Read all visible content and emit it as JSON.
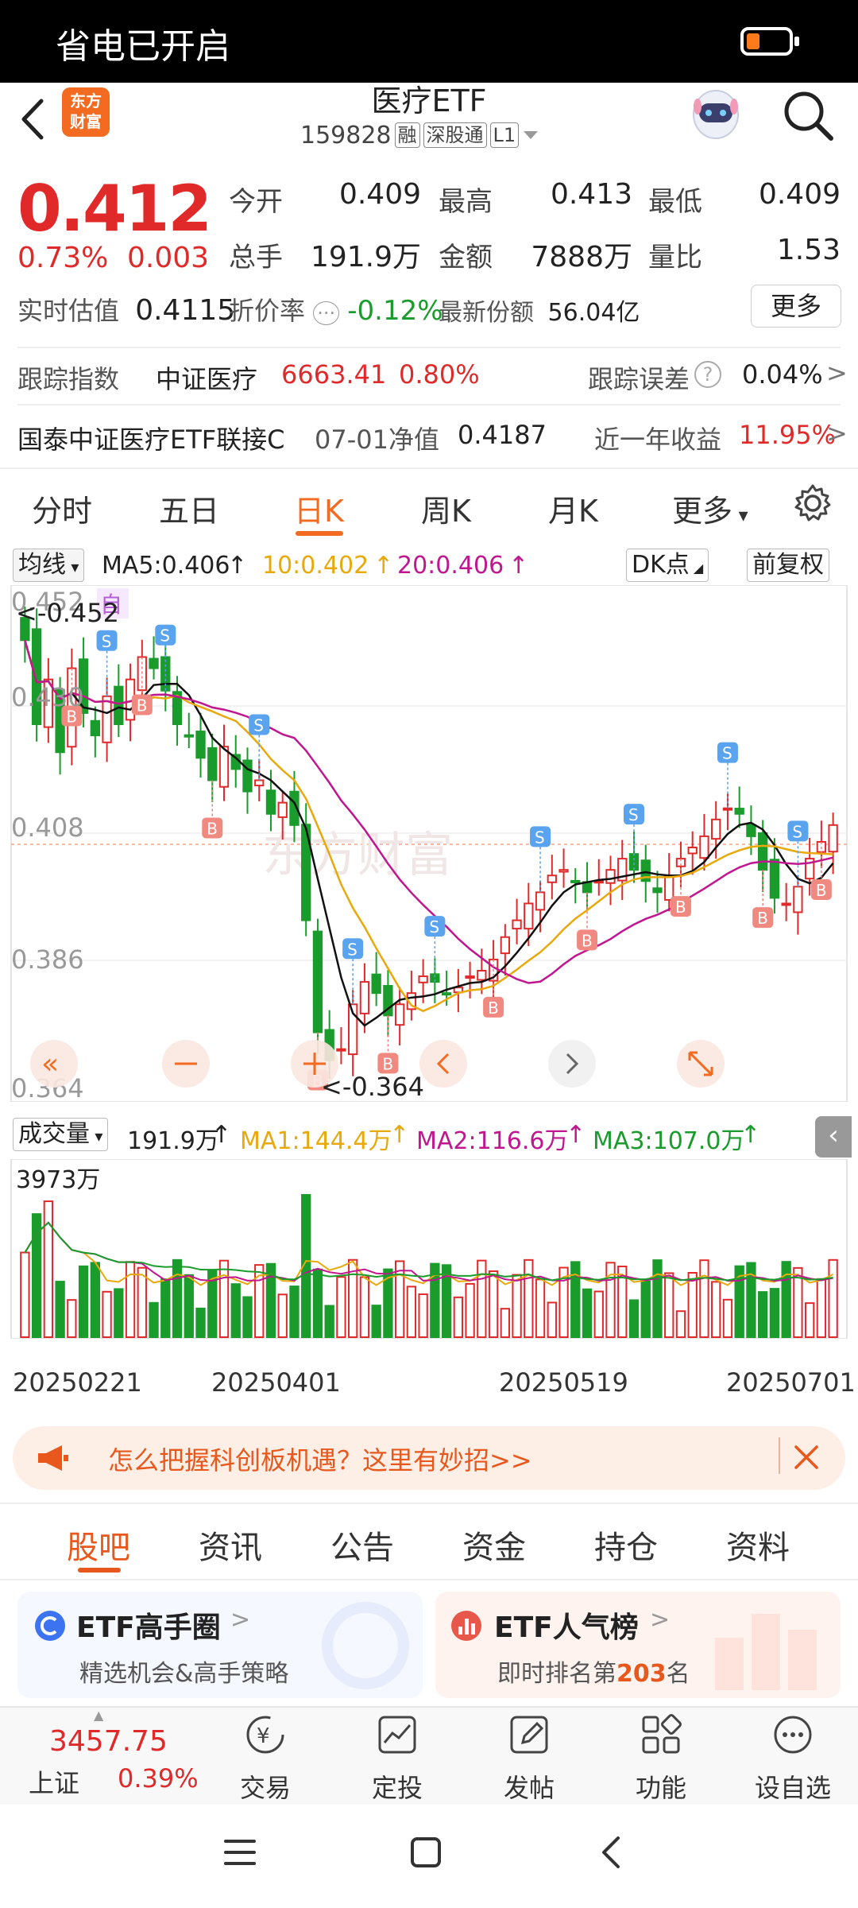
{
  "status_bar": {
    "text": "省电已开启"
  },
  "header": {
    "logo": [
      "东方",
      "财富"
    ],
    "title": "医疗ETF",
    "code": "159828",
    "tags": [
      "融",
      "深股通",
      "L1"
    ]
  },
  "quote": {
    "price": "0.412",
    "pct": "0.73%",
    "change": "0.003",
    "today_open_label": "今开",
    "today_open": "0.409",
    "high_label": "最高",
    "high": "0.413",
    "low_label": "最低",
    "low": "0.409",
    "volume_label": "总手",
    "volume": "191.9万",
    "amount_label": "金额",
    "amount": "7888万",
    "ratio_label": "量比",
    "ratio": "1.53",
    "est_label": "实时估值",
    "est_value": "0.4115",
    "discount_label": "折价率",
    "discount": "-0.12%",
    "shares_label": "最新份额",
    "shares": "56.04亿",
    "more_btn": "更多"
  },
  "tracking": {
    "index_label": "跟踪指数",
    "index_name": "中证医疗",
    "index_value": "6663.41",
    "index_pct": "0.80%",
    "error_label": "跟踪误差",
    "error_value": "0.04%",
    "link_fund": "国泰中证医疗ETF联接C",
    "nav_label": "07-01净值",
    "nav_value": "0.4187",
    "year_label": "近一年收益",
    "year_value": "11.95%"
  },
  "period_tabs": [
    "分时",
    "五日",
    "日K",
    "周K",
    "月K",
    "更多"
  ],
  "active_period": "日K",
  "chart_controls": {
    "ma_select": "均线",
    "ma5": "MA5:0.406",
    "ma10": "10:0.402",
    "ma20": "20:0.406",
    "dk": "DK点",
    "adjust": "前复权",
    "self_tag": "自",
    "price_max_marker": "<-0.452",
    "price_min_marker": "<-0.364",
    "vol_select": "成交量",
    "vol_value": "191.9万",
    "vol_ma1": "MA1:144.4万",
    "vol_ma2": "MA2:116.6万",
    "vol_ma3": "MA3:107.0万",
    "vol_max": "3973万",
    "watermark": "东方财富"
  },
  "chart_data": {
    "type": "candlestick",
    "y_ticks": [
      "0.452",
      "0.430",
      "0.408",
      "0.386",
      "0.364"
    ],
    "ylim": [
      0.364,
      0.452
    ],
    "x_labels": [
      "20250221",
      "20250401",
      "20250519",
      "20250701"
    ],
    "close": [
      0.445,
      0.43,
      0.438,
      0.425,
      0.44,
      0.432,
      0.428,
      0.435,
      0.43,
      0.438,
      0.442,
      0.44,
      0.436,
      0.43,
      0.428,
      0.424,
      0.42,
      0.426,
      0.422,
      0.418,
      0.42,
      0.414,
      0.416,
      0.412,
      0.395,
      0.375,
      0.37,
      0.372,
      0.38,
      0.384,
      0.382,
      0.378,
      0.38,
      0.382,
      0.385,
      0.384,
      0.382,
      0.383,
      0.385,
      0.386,
      0.388,
      0.392,
      0.395,
      0.398,
      0.4,
      0.403,
      0.404,
      0.402,
      0.4,
      0.402,
      0.404,
      0.406,
      0.404,
      0.402,
      0.4,
      0.403,
      0.406,
      0.408,
      0.41,
      0.413,
      0.415,
      0.414,
      0.41,
      0.404,
      0.399,
      0.398,
      0.401,
      0.406,
      0.409,
      0.412
    ],
    "ma5_last": 0.406,
    "ma10_last": 0.402,
    "ma20_last": 0.406,
    "volume_unit": "万手",
    "volume_max": 3973
  },
  "banner": {
    "text": "怎么把握科创板机遇？这里有妙招>>"
  },
  "section_tabs": [
    "股吧",
    "资讯",
    "公告",
    "资金",
    "持仓",
    "资料"
  ],
  "active_section": "股吧",
  "cards": [
    {
      "title": "ETF高手圈",
      "sub": "精选机会&高手策略"
    },
    {
      "title": "ETF人气榜",
      "sub_prefix": "即时排名第",
      "rank": "203",
      "sub_suffix": "名"
    }
  ],
  "bottom_nav": {
    "index_value": "3457.75",
    "index_name": "上证",
    "index_pct": "0.39%",
    "items": [
      "交易",
      "定投",
      "发帖",
      "功能",
      "设自选"
    ]
  }
}
